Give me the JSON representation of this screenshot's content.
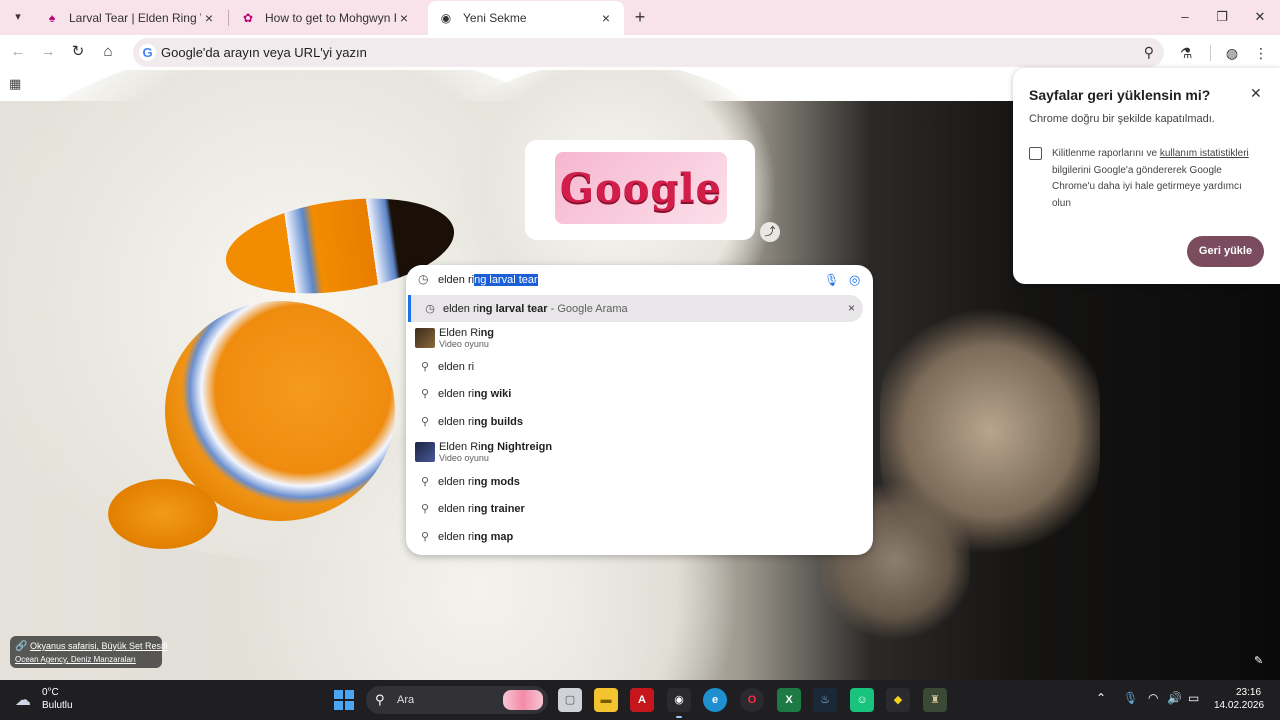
{
  "tabs": [
    {
      "title": "Larval Tear | Elden Ring Wiki",
      "icon": "fextralife-favicon-icon"
    },
    {
      "title": "How to get to Mohgwyn Palace",
      "icon": "game8-favicon-icon"
    },
    {
      "title": "Yeni Sekme",
      "icon": "chrome-favicon-icon"
    }
  ],
  "omnibox": {
    "placeholder": "Google'da arayın veya URL'yi yazın"
  },
  "doodle": {
    "text": "Google"
  },
  "search": {
    "typed": "elden ri",
    "autocompleted": "ng larval tear",
    "suggestions": {
      "s1": {
        "pre": "elden ri",
        "bold": "ng larval tear",
        "suffix": " - Google Arama"
      },
      "s2": {
        "title_pre": "Elden Ri",
        "title_bold": "ng",
        "subtitle": "Video oyunu"
      },
      "s3": {
        "pre": "elden ri",
        "bold": ""
      },
      "s4": {
        "pre": "elden ri",
        "bold": "ng wiki"
      },
      "s5": {
        "pre": "elden ri",
        "bold": "ng builds"
      },
      "s6": {
        "title_pre": "Elden Ri",
        "title_bold": "ng Nightreign",
        "subtitle": "Video oyunu"
      },
      "s7": {
        "pre": "elden ri",
        "bold": "ng mods"
      },
      "s8": {
        "pre": "elden ri",
        "bold": "ng trainer"
      },
      "s9": {
        "pre": "elden ri",
        "bold": "ng map"
      }
    }
  },
  "restore_bubble": {
    "title": "Sayfalar geri yüklensin mi?",
    "description": "Chrome doğru bir şekilde kapatılmadı.",
    "consent_pre": "Kilitlenme raporlarını ve ",
    "consent_link": "kullanım istatistikleri",
    "consent_post": " bilgilerini Google'a göndererek Google Chrome'u daha iyi hale getirmeye yardımcı olun",
    "button": "Geri yükle",
    "checked": false
  },
  "photo_credit": {
    "title": "Okyanus safarisi, Büyük Set Resifi",
    "subtitle": "Ocean Agency, Deniz Manzaraları"
  },
  "taskbar": {
    "weather_temp": "0°C",
    "weather_condition": "Bulutlu",
    "search_placeholder": "Ara",
    "time": "23:16",
    "date": "14.02.2026"
  },
  "colors": {
    "tabstrip": "#f8e3ea",
    "accent_button": "#7a4c5e",
    "selection": "#1a5fd6",
    "taskbar": "#1f1f22"
  }
}
